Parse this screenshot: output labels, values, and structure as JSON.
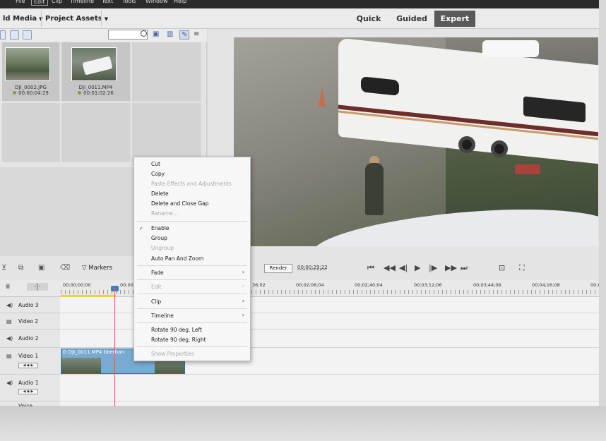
{
  "menubar": {
    "items": [
      "File",
      "Edit",
      "Clip",
      "Timeline",
      "Text",
      "Tools",
      "Window",
      "Help"
    ],
    "active": "Edit"
  },
  "toolbar": {
    "add_media": "ld Media",
    "project_assets": "Project Assets"
  },
  "modes": {
    "quick": "Quick",
    "guided": "Guided",
    "expert": "Expert",
    "active": "Expert"
  },
  "media": {
    "items": [
      {
        "name": "DJI_0002.JPG",
        "duration": "00:00:04:29"
      },
      {
        "name": "DJI_0011.MP4",
        "duration": "00:01:02:26"
      }
    ]
  },
  "transport": {
    "markers": "Markers",
    "render": "Render",
    "timecode": "00;00;29;22"
  },
  "ruler": {
    "labels": [
      "00;00;00;00",
      "00;00",
      "36;02",
      "00;02;08;04",
      "00;02;40;04",
      "00;03;12;06",
      "00;03;44;06",
      "00;04;16;08",
      "00;0"
    ]
  },
  "tracks": [
    {
      "name": "Audio 3",
      "type": "audio"
    },
    {
      "name": "Video 2",
      "type": "video"
    },
    {
      "name": "Audio 2",
      "type": "audio"
    },
    {
      "name": "Video 1",
      "type": "video"
    },
    {
      "name": "Audio 1",
      "type": "audio"
    },
    {
      "name": "Voice",
      "type": "audio"
    }
  ],
  "clip": {
    "label": "D  DJI_0011.MP4  bberban"
  },
  "context_menu": {
    "items": {
      "cut": "Cut",
      "copy": "Copy",
      "paste_effects": "Paste Effects and Adjustments",
      "delete": "Delete",
      "delete_close_gap": "Delete and Close Gap",
      "rename": "Rename...",
      "enable": "Enable",
      "group": "Group",
      "ungroup": "Ungroup",
      "auto_pan_zoom": "Auto Pan And Zoom",
      "fade": "Fade",
      "edit": "Edit",
      "clip": "Clip",
      "timeline": "Timeline",
      "rotate_left": "Rotate 90 deg. Left",
      "rotate_right": "Rotate 90 deg. Right",
      "show_properties": "Show Properties"
    },
    "checkmark": "✓",
    "submenu_arrow": "›"
  },
  "colors": {
    "accent_blue": "#3b7fc2",
    "playhead": "#e25a5a",
    "active_mode_bg": "#5a5a5a",
    "clip": "#78aad2"
  }
}
